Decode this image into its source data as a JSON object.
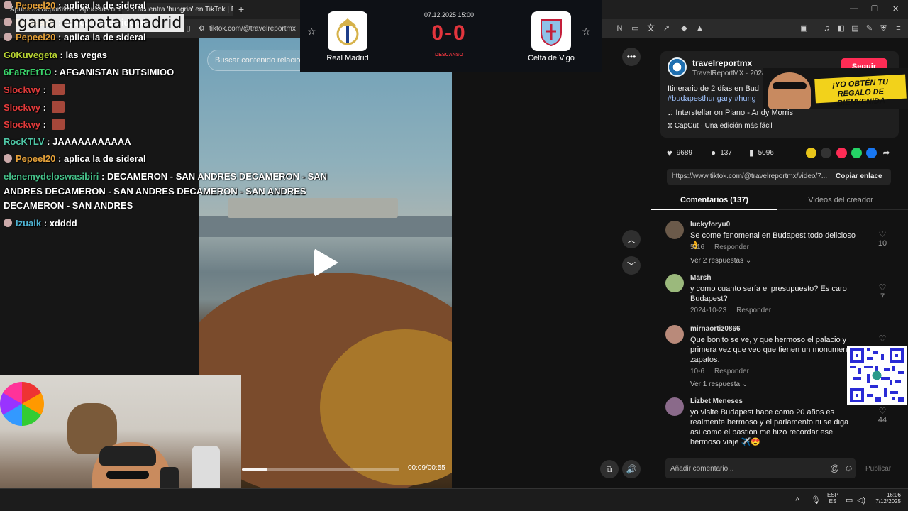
{
  "browser": {
    "tabs": [
      {
        "title": "Apuestas deportivas | Apuestas onli"
      },
      {
        "title": "Encuentra 'hungria' en TikTok | B"
      }
    ],
    "url": "tiktok.com/@travelreportmx"
  },
  "video": {
    "search_placeholder": "Buscar contenido relacio",
    "timecode": "00:09/00:55",
    "progress_fraction": 0.16
  },
  "match": {
    "datetime": "07.12.2025 15:00",
    "score": "0-0",
    "status": "DESCANSO",
    "home_team": "Real Madrid",
    "away_team": "Celta de Vigo"
  },
  "creator": {
    "username": "travelreportmx",
    "subtitle": "TravelReportMX · 2024",
    "follow_label": "Seguir",
    "description": "Itinerario de 2 días en Bud",
    "hashtags": "#budapesthungary #hung",
    "music": "Interstellar on Piano - Andy Morris",
    "capcut": "CapCut · Una edición más fácil"
  },
  "stats": {
    "likes": "9689",
    "comments": "137",
    "saves": "5096"
  },
  "link": {
    "url": "https://www.tiktok.com/@travelreportmx/video/7...",
    "copy_label": "Copiar enlace"
  },
  "tabs": {
    "comments": "Comentarios (137)",
    "creator_videos": "Videos del creador"
  },
  "comments": [
    {
      "user": "luckyforyu0",
      "text": "Se come fenomenal en Budapest todo delicioso 👌",
      "date": "5-16",
      "reply": "Responder",
      "replies": "Ver 2 respuestas ⌄",
      "likes": "10"
    },
    {
      "user": "Marsh",
      "text": "y como cuanto sería el presupuesto? Es caro Budapest?",
      "date": "2024-10-23",
      "reply": "Responder",
      "likes": "7"
    },
    {
      "user": "mirnaortiz0866",
      "text": "Que bonito se ve, y que hermoso el palacio y primera vez que veo que tienen un monumen los zapatos.",
      "date": "10-6",
      "reply": "Responder",
      "replies": "Ver 1 respuesta ⌄",
      "likes": ""
    },
    {
      "user": "Lizbet Meneses",
      "text": "yo visite Budapest hace como 20 años es realmente hermoso y el parlamento ni se diga así como el bastión me hizo recordar ese hermoso viaje ✈️😍",
      "likes": "44"
    }
  ],
  "comment_input": {
    "placeholder": "Añadir comentario...",
    "publish": "Publicar"
  },
  "overlay": {
    "title": "gana empata madrid",
    "promo": "¡YO OBTÉN TU REGALO DE BIENVENIDA"
  },
  "chat": [
    {
      "user": "Pepeel20",
      "color": "#e8a33a",
      "msg": "aplica la de sideral"
    },
    {
      "user": "Pepeel20",
      "color": "#e8a33a",
      "msg": "aplica la de sideral"
    },
    {
      "user": "Pepeel20",
      "color": "#e8a33a",
      "msg": "aplica la de sideral"
    },
    {
      "user": "G0Kuvegeta",
      "color": "#b8d432",
      "msg": "las vegas"
    },
    {
      "user": "6FaRrEtTO",
      "color": "#3bd46b",
      "msg": "AFGANISTAN BUTSIMIOO"
    },
    {
      "user": "Slockwy",
      "color": "#e23b3b",
      "msg": ""
    },
    {
      "user": "Slockwy",
      "color": "#e23b3b",
      "msg": ""
    },
    {
      "user": "Slockwy",
      "color": "#e23b3b",
      "msg": ""
    },
    {
      "user": "RocKTLV",
      "color": "#4fc7a6",
      "msg": "JAAAAAAAAAAA"
    },
    {
      "user": "Pepeel20",
      "color": "#e8a33a",
      "msg": "aplica la de sideral"
    },
    {
      "user": "elenemydeloswasibiri",
      "color": "#46c28a",
      "msg": "DECAMERON - SAN ANDRES DECAMERON - SAN"
    },
    {
      "user": "",
      "color": "#fff",
      "msg": "ANDRES DECAMERON - SAN ANDRES DECAMERON - SAN ANDRES"
    },
    {
      "user": "",
      "color": "#fff",
      "msg": "DECAMERON - SAN ANDRES"
    },
    {
      "user": "Izuaik",
      "color": "#4fb4d4",
      "msg": "xdddd"
    }
  ],
  "taskbar": {
    "lang_top": "ESP",
    "lang_bottom": "ES",
    "time": "16:06",
    "date": "7/12/2025"
  }
}
